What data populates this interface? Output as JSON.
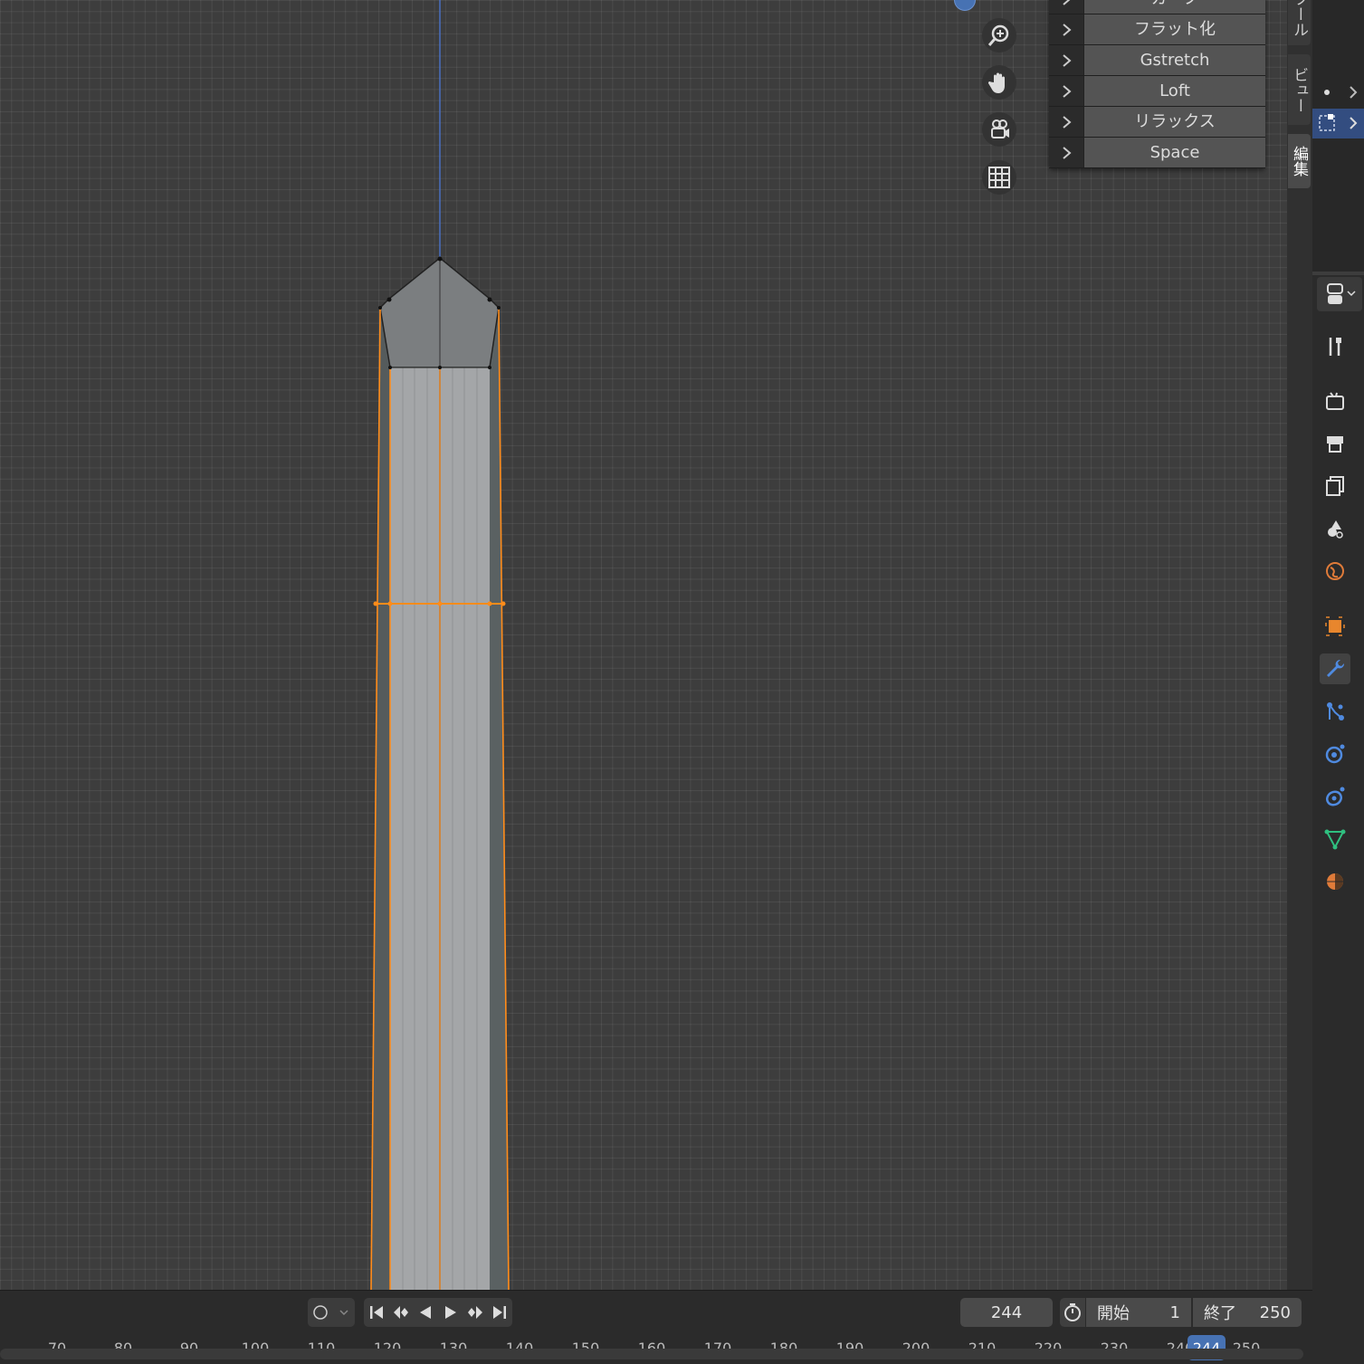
{
  "viewport": {
    "nav_icons": [
      "zoom-icon",
      "hand-pan-icon",
      "camera-view-icon",
      "ortho-grid-icon"
    ]
  },
  "loop_tools_panel": {
    "items": [
      {
        "label": "カーブ"
      },
      {
        "label": "フラット化"
      },
      {
        "label": "Gstretch"
      },
      {
        "label": "Loft"
      },
      {
        "label": "リラックス"
      },
      {
        "label": "Space"
      }
    ]
  },
  "sidebar_tabs": {
    "tool": "ツール",
    "view": "ビュー",
    "edit": "編集"
  },
  "properties": {
    "icons": [
      "tool-icon",
      "render-icon",
      "output-icon",
      "view-layer-icon",
      "scene-icon",
      "world-icon",
      "object-icon",
      "modifier-icon",
      "particles-icon",
      "physics-icon",
      "constraints-icon",
      "data-icon",
      "material-icon"
    ],
    "active": "modifier-icon",
    "colors": {
      "active_accent": "#4772b3",
      "object": "#e8862d",
      "data": "#2fbf7f"
    }
  },
  "timeline": {
    "current_frame": "244",
    "start_label": "開始",
    "start_value": "1",
    "end_label": "終了",
    "end_value": "250",
    "ruler_ticks": [
      "70",
      "80",
      "90",
      "100",
      "110",
      "120",
      "130",
      "140",
      "150",
      "160",
      "170",
      "180",
      "190",
      "200",
      "210",
      "220",
      "230",
      "240",
      "250"
    ],
    "cursor_label": "244"
  },
  "colors": {
    "selection": "#ff8c1a",
    "viewport_bg": "#3d3d3d",
    "face": "#a4a6a8"
  }
}
